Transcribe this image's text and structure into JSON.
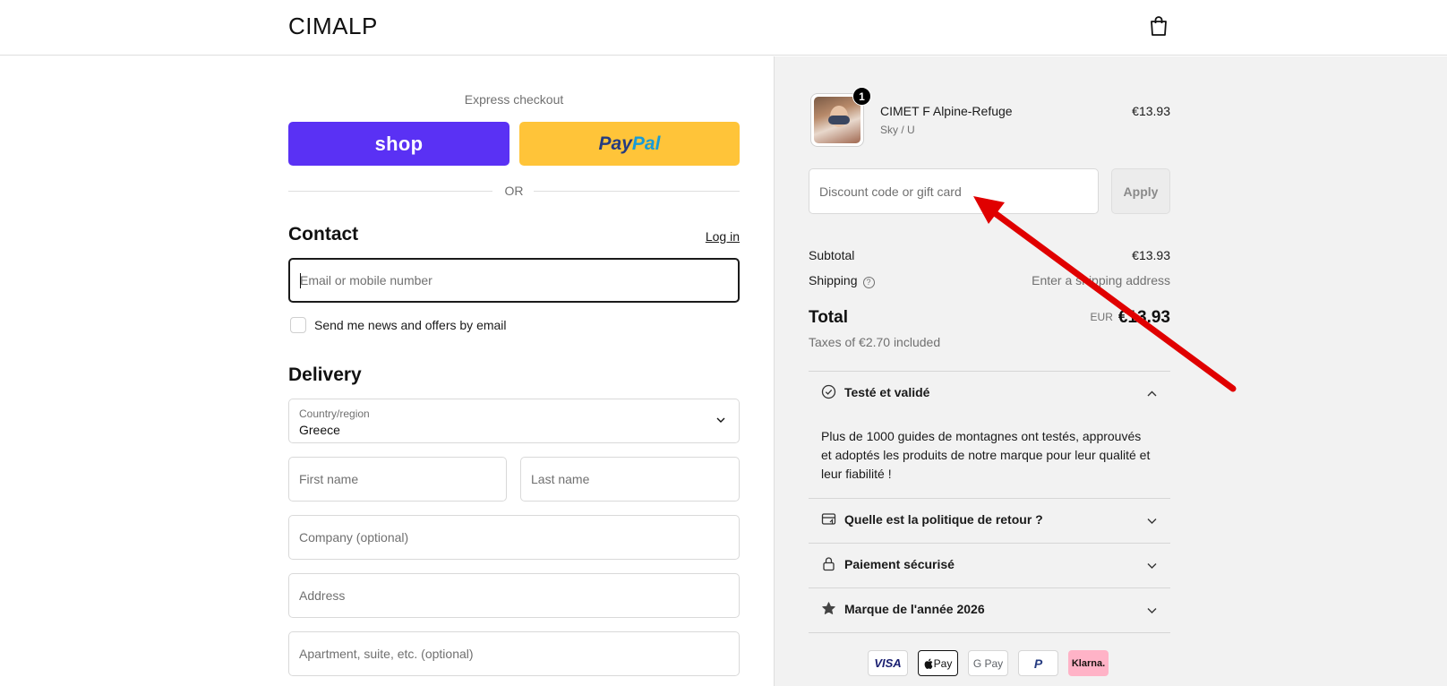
{
  "header": {
    "logo": "CIMALP",
    "cart_icon": "shopping-bag-icon"
  },
  "express": {
    "label": "Express checkout",
    "shop_label": "shop",
    "paypal_a": "Pay",
    "paypal_b": "Pal",
    "or_label": "OR"
  },
  "contact": {
    "title": "Contact",
    "login_label": "Log in",
    "email_placeholder": "Email or mobile number",
    "newsletter_label": "Send me news and offers by email"
  },
  "delivery": {
    "title": "Delivery",
    "country_label": "Country/region",
    "country_value": "Greece",
    "first_name_placeholder": "First name",
    "last_name_placeholder": "Last name",
    "company_placeholder": "Company (optional)",
    "address_placeholder": "Address",
    "apartment_placeholder": "Apartment, suite, etc. (optional)"
  },
  "summary": {
    "item": {
      "quantity": "1",
      "name": "CIMET F Alpine-Refuge",
      "variant": "Sky / U",
      "price": "€13.93"
    },
    "discount_placeholder": "Discount code or gift card",
    "apply_label": "Apply",
    "subtotal_label": "Subtotal",
    "subtotal_value": "€13.93",
    "shipping_label": "Shipping",
    "shipping_value": "Enter a shipping address",
    "total_label": "Total",
    "total_currency": "EUR",
    "total_value": "€13.93",
    "taxes": "Taxes of €2.70 included"
  },
  "accordions": [
    {
      "title": "Testé et validé",
      "icon": "check-circle-icon",
      "expanded": true,
      "body": "Plus de 1000 guides de montagnes ont testés, approuvés et adoptés les produits de notre marque pour leur qualité et leur fiabilité !"
    },
    {
      "title": "Quelle est la politique de retour ?",
      "icon": "return-box-icon",
      "expanded": false
    },
    {
      "title": "Paiement sécurisé",
      "icon": "lock-icon",
      "expanded": false
    },
    {
      "title": "Marque de l'année 2026",
      "icon": "star-icon",
      "expanded": false
    }
  ],
  "payment_methods": [
    "VISA",
    "Pay",
    "G Pay",
    "P",
    "Klarna."
  ],
  "colors": {
    "shop_purple": "#5a31f4",
    "paypal_yellow": "#ffc439",
    "annotation_red": "#e00000",
    "summary_bg": "#f2f2f2"
  }
}
